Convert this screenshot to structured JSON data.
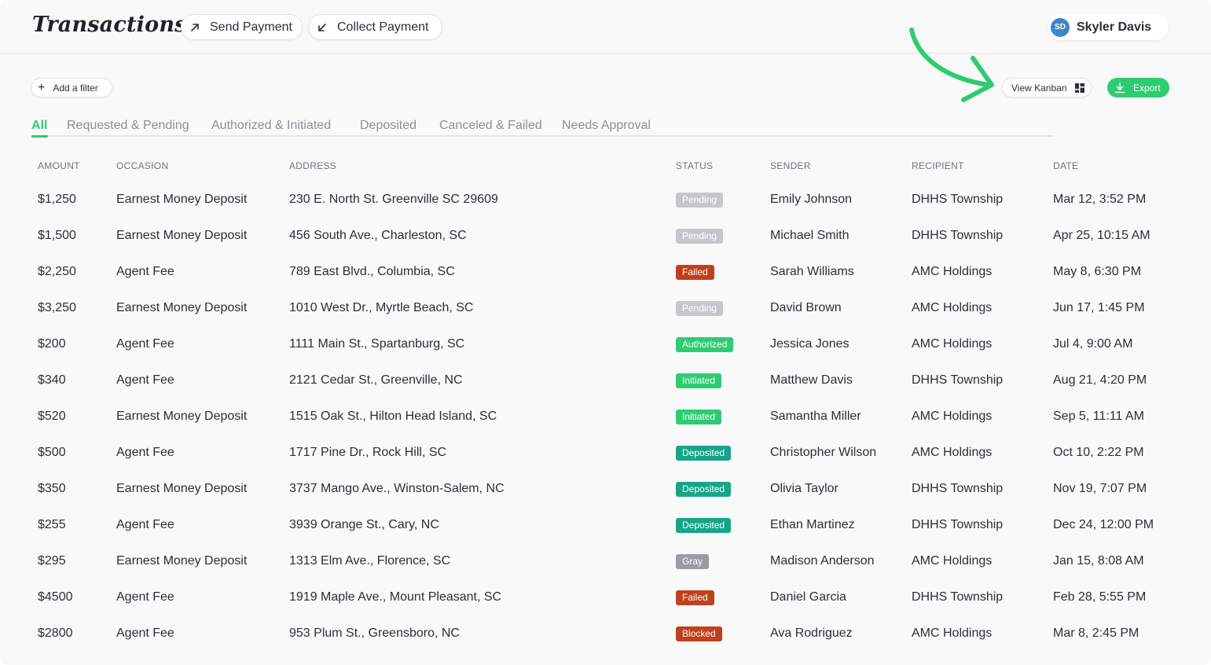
{
  "header": {
    "title": "Transactions",
    "send_payment_label": "Send Payment",
    "collect_payment_label": "Collect Payment",
    "user": {
      "initials": "SD",
      "name": "Skyler Davis"
    }
  },
  "toolbar": {
    "add_filter_label": "Add a filter",
    "view_kanban_label": "View Kanban",
    "export_label": "Export"
  },
  "tabs": [
    {
      "label": "All",
      "active": true
    },
    {
      "label": "Requested & Pending",
      "active": false
    },
    {
      "label": "Authorized & Initiated",
      "active": false
    },
    {
      "label": "Deposited",
      "active": false
    },
    {
      "label": "Canceled & Failed",
      "active": false
    },
    {
      "label": "Needs Approval",
      "active": false
    }
  ],
  "columns": [
    "AMOUNT",
    "OCCASION",
    "ADDRESS",
    "STATUS",
    "SENDER",
    "RECIPIENT",
    "DATE"
  ],
  "status_colors": {
    "Pending": "#c4c7cc",
    "Failed": "#c0401c",
    "Authorized": "#2ecc71",
    "Initiated": "#2ecc71",
    "Deposited": "#17a589",
    "Gray": "#9a9ca1",
    "Blocked": "#c0401c"
  },
  "rows": [
    {
      "amount": "$1,250",
      "occasion": "Earnest Money Deposit",
      "address": "230 E. North St. Greenville SC 29609",
      "status": "Pending",
      "sender": "Emily Johnson",
      "recipient": "DHHS Township",
      "date": "Mar 12, 3:52 PM"
    },
    {
      "amount": "$1,500",
      "occasion": "Earnest Money Deposit",
      "address": "456 South Ave., Charleston, SC",
      "status": "Pending",
      "sender": "Michael Smith",
      "recipient": "DHHS Township",
      "date": "Apr 25, 10:15 AM"
    },
    {
      "amount": "$2,250",
      "occasion": "Agent Fee",
      "address": "789 East Blvd., Columbia, SC",
      "status": "Failed",
      "sender": "Sarah Williams",
      "recipient": "AMC Holdings",
      "date": "May 8, 6:30 PM"
    },
    {
      "amount": "$3,250",
      "occasion": "Earnest Money Deposit",
      "address": "1010 West Dr., Myrtle Beach, SC",
      "status": "Pending",
      "sender": "David Brown",
      "recipient": "AMC Holdings",
      "date": "Jun 17, 1:45 PM"
    },
    {
      "amount": "$200",
      "occasion": "Agent Fee",
      "address": "1111 Main St., Spartanburg, SC",
      "status": "Authorized",
      "sender": "Jessica Jones",
      "recipient": "AMC Holdings",
      "date": "Jul 4, 9:00 AM"
    },
    {
      "amount": "$340",
      "occasion": "Agent Fee",
      "address": "2121 Cedar St., Greenville, NC",
      "status": "Initiated",
      "sender": "Matthew Davis",
      "recipient": "DHHS Township",
      "date": "Aug 21, 4:20 PM"
    },
    {
      "amount": "$520",
      "occasion": "Earnest Money Deposit",
      "address": "1515 Oak St., Hilton Head Island, SC",
      "status": "Initiated",
      "sender": "Samantha Miller",
      "recipient": "AMC Holdings",
      "date": "Sep 5, 11:11 AM"
    },
    {
      "amount": "$500",
      "occasion": "Agent Fee",
      "address": "1717 Pine Dr., Rock Hill, SC",
      "status": "Deposited",
      "sender": "Christopher Wilson",
      "recipient": "AMC Holdings",
      "date": "Oct 10, 2:22 PM"
    },
    {
      "amount": "$350",
      "occasion": "Earnest Money Deposit",
      "address": "3737 Mango Ave., Winston-Salem, NC",
      "status": "Deposited",
      "sender": "Olivia Taylor",
      "recipient": "DHHS Township",
      "date": "Nov 19, 7:07 PM"
    },
    {
      "amount": "$255",
      "occasion": "Agent Fee",
      "address": "3939 Orange St., Cary, NC",
      "status": "Deposited",
      "sender": "Ethan Martinez",
      "recipient": "DHHS Township",
      "date": "Dec 24, 12:00 PM"
    },
    {
      "amount": "$295",
      "occasion": "Earnest Money Deposit",
      "address": "1313 Elm Ave., Florence, SC",
      "status": "Gray",
      "sender": "Madison Anderson",
      "recipient": "AMC Holdings",
      "date": "Jan 15, 8:08 AM"
    },
    {
      "amount": "$4500",
      "occasion": "Agent Fee",
      "address": "1919 Maple Ave., Mount Pleasant, SC",
      "status": "Failed",
      "sender": "Daniel Garcia",
      "recipient": "DHHS Township",
      "date": "Feb 28, 5:55 PM"
    },
    {
      "amount": "$2800",
      "occasion": "Agent Fee",
      "address": "953 Plum St., Greensboro, NC",
      "status": "Blocked",
      "sender": "Ava Rodriguez",
      "recipient": "AMC Holdings",
      "date": "Mar 8, 2:45 PM"
    }
  ],
  "icons": {
    "send": "arrow-up-right-icon",
    "collect": "arrow-down-left-icon",
    "filter": "plus-icon",
    "kanban": "grid-icon",
    "export": "download-icon",
    "annotation": "curved-arrow-icon"
  },
  "accent_color": "#2ecc71"
}
